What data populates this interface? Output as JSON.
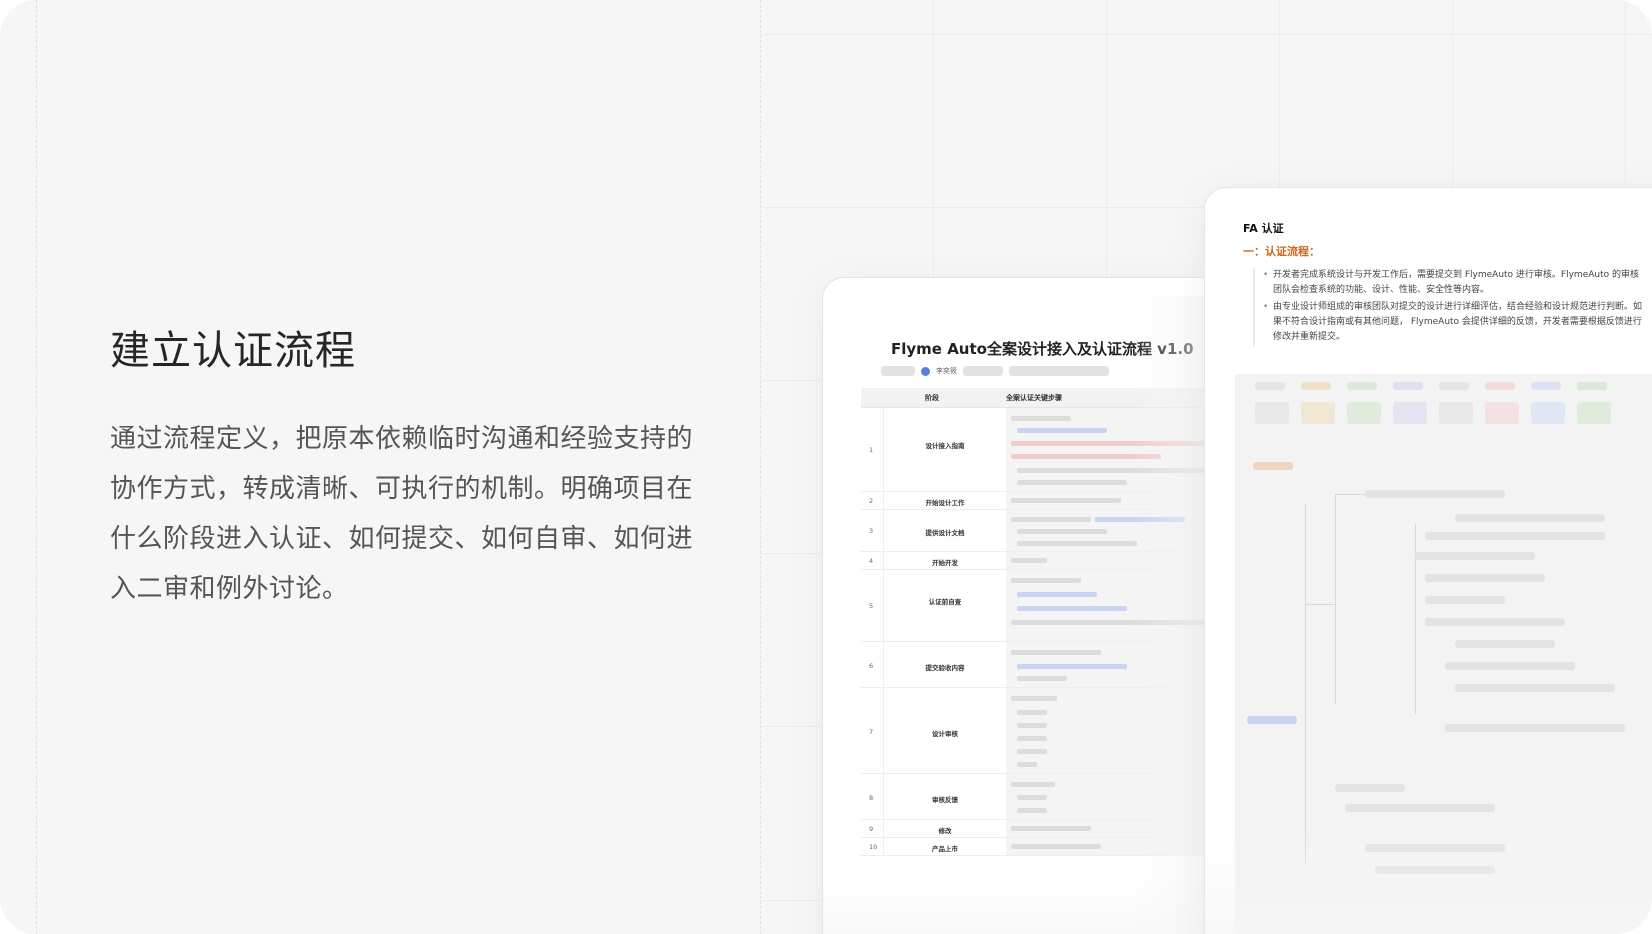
{
  "section": {
    "heading": "建立认证流程",
    "description": "通过流程定义，把原本依赖临时沟通和经验支持的协作方式，转成清晰、可执行的机制。明确项目在什么阶段进入认证、如何提交、如何自审、如何进入二审和例外讨论。"
  },
  "doc1": {
    "title": "Flyme Auto全案设计接入及认证流程 v1.0",
    "author": "李奕筱",
    "columns": [
      "阶段",
      "全案认证关键步骤"
    ],
    "rows": [
      {
        "num": "1",
        "phase": "设计接入指南"
      },
      {
        "num": "2",
        "phase": "开始设计工作"
      },
      {
        "num": "3",
        "phase": "提供设计文档"
      },
      {
        "num": "4",
        "phase": "开始开发"
      },
      {
        "num": "5",
        "phase": "认证前自查"
      },
      {
        "num": "6",
        "phase": "提交验收内容"
      },
      {
        "num": "7",
        "phase": "设计审核"
      },
      {
        "num": "8",
        "phase": "审核反馈"
      },
      {
        "num": "9",
        "phase": "修改"
      },
      {
        "num": "10",
        "phase": "产品上市"
      }
    ]
  },
  "doc2": {
    "title": "FA 认证",
    "subtitle": "一：认证流程：",
    "paragraphs": [
      "开发者完成系统设计与开发工作后，需要提交到 FlymeAuto 进行审核。FlymeAuto 的审核团队会检查系统的功能、设计、性能、安全性等内容。",
      "由专业设计师组成的审核团队对提交的设计进行详细评估，结合经验和设计规范进行判断。如果不符合设计指南或有其他问题， FlymeAuto 会提供详细的反馈，开发者需要根据反馈进行修改并重新提交。"
    ],
    "accent_color": "#d4651a"
  }
}
